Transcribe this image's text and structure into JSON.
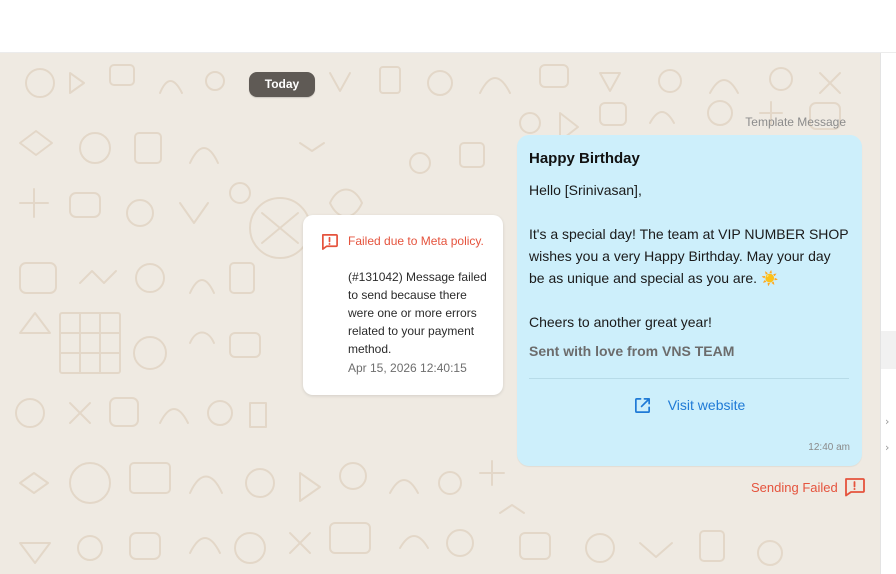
{
  "date_chip": "Today",
  "template_label": "Template Message",
  "error_card": {
    "title": "Failed due to Meta policy.",
    "body": "(#131042) Message failed to send because there were one or more errors related to your payment method.",
    "timestamp": "Apr 15, 2026 12:40:15",
    "icon": "alert-message-icon"
  },
  "message": {
    "title": "Happy Birthday",
    "greeting": "Hello [Srinivasan],",
    "body": "It's a special day! The team at VIP NUMBER SHOP wishes you a very Happy Birthday. May your day be as unique and special as you are.",
    "emoji": "☀️",
    "closing": "Cheers to another great year!",
    "footer": "Sent with love from VNS TEAM",
    "button_label": "Visit website",
    "button_icon": "external-link-icon",
    "time": "12:40 am"
  },
  "send_status": {
    "label": "Sending Failed",
    "icon": "alert-message-icon"
  },
  "colors": {
    "bubble": "#cdeffb",
    "error": "#e5533d",
    "link": "#1f7ad6",
    "wallpaper": "#efeae2"
  }
}
